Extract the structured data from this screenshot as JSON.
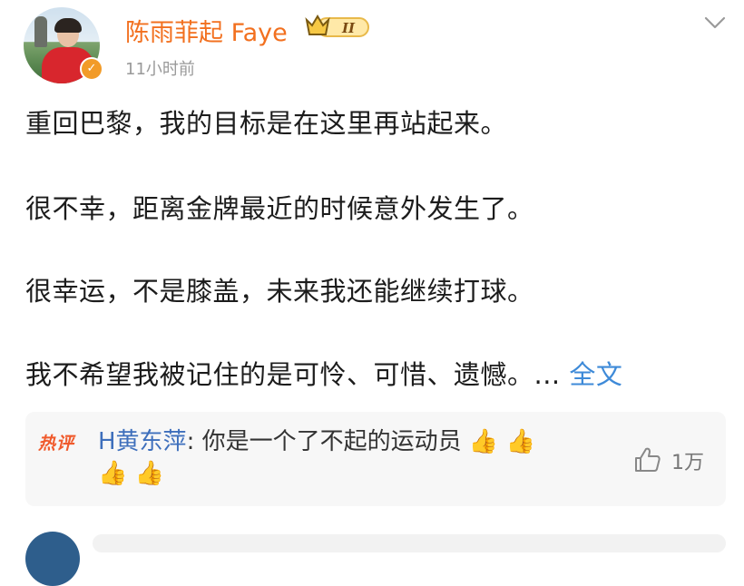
{
  "post": {
    "author": "陈雨菲起 Faye",
    "vip_level": "II",
    "verified_icon": "verified-badge-icon",
    "time": "11小时前",
    "paragraphs": [
      "重回巴黎，我的目标是在这里再站起来。",
      "很不幸，距离金牌最近的时候意外发生了。",
      "很幸运，不是膝盖，未来我还能继续打球。",
      "我不希望我被记住的是可怜、可惜、遗憾。..."
    ],
    "more_link": "全文",
    "accent_color": "#f2701f",
    "link_color": "#3e8ad8"
  },
  "hot_comment": {
    "label": "热评",
    "user": "H黄东萍",
    "separator": ": ",
    "text": "你是一个了不起的运动员",
    "thumbs_line1": "👍 👍",
    "thumbs_line2": "👍 👍",
    "like_icon": "thumbs-up-outline-icon",
    "like_count": "1万"
  }
}
